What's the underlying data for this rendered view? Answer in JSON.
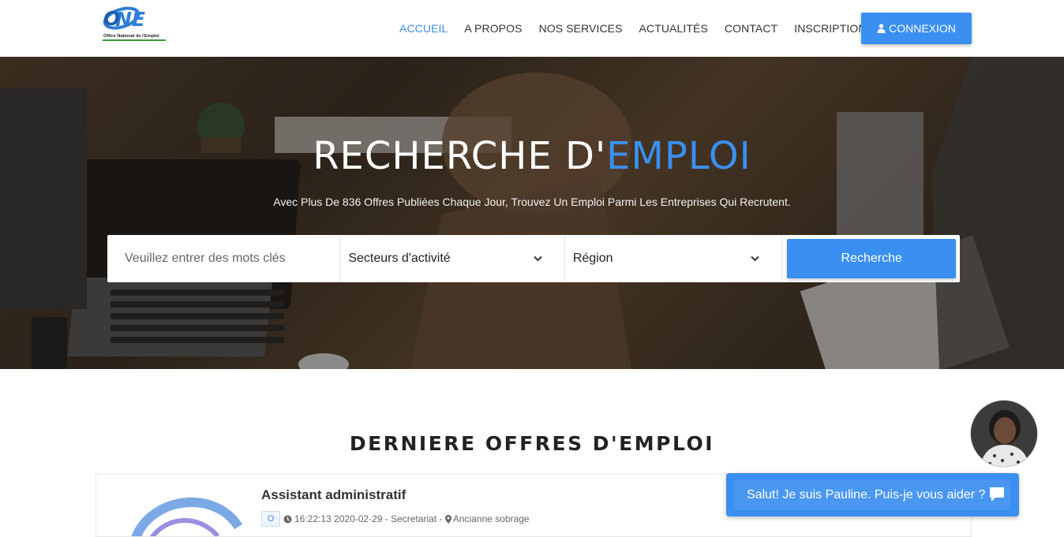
{
  "brand": {
    "logo_text": "ONE",
    "logo_subtitle": "Office National de l'Emploi"
  },
  "nav": {
    "items": [
      {
        "label": "ACCUEIL",
        "active": true
      },
      {
        "label": "A PROPOS",
        "active": false
      },
      {
        "label": "NOS SERVICES",
        "active": false
      },
      {
        "label": "ACTUALITÉS",
        "active": false
      },
      {
        "label": "CONTACT",
        "active": false
      },
      {
        "label": "INSCRIPTION",
        "active": false
      }
    ],
    "login_label": "CONNEXION",
    "login_icon": "user-icon"
  },
  "hero": {
    "title_main": "RECHERCHE D'",
    "title_accent": "EMPLOI",
    "subtitle": "Avec Plus De 836 Offres Publiées Chaque Jour, Trouvez Un Emploi Parmi Les Entreprises Qui Recrutent."
  },
  "search": {
    "keywords_placeholder": "Veuillez entrer des mots clés",
    "sector_selected": "Secteurs d'activité",
    "region_selected": "Région",
    "button_label": "Recherche"
  },
  "offers": {
    "section_title": "DERNIERE OFFRES D'EMPLOI",
    "items": [
      {
        "title": "Assistant administratif",
        "badge": "O",
        "datetime": "16:22:13 2020-02-29",
        "sector": "Secretariat",
        "location": "Ancianne sobrage"
      }
    ]
  },
  "chat": {
    "message": "Salut! Je suis Pauline. Puis-je vous aider ?"
  },
  "colors": {
    "accent": "#3a8ff0",
    "nav_active": "#3a8de8",
    "text_dark": "#222222"
  }
}
